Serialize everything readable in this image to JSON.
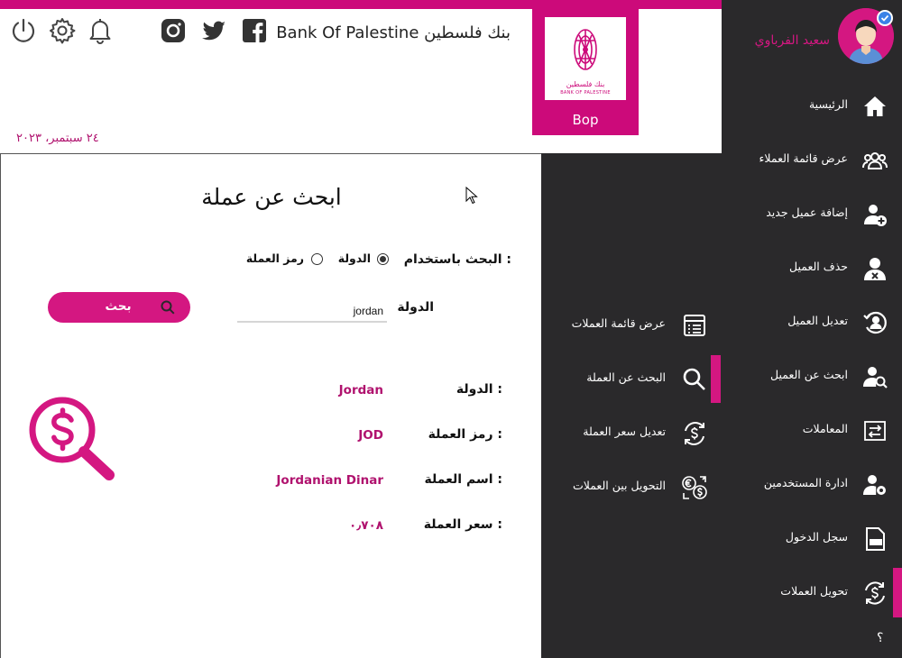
{
  "header": {
    "bank_title": "Bank Of Palestine بنك فلسطين",
    "date": "٢٤ سبتمبر، ٢٠٢٣",
    "logo": {
      "caption": "Bop",
      "text_ar": "بنك فلسطين",
      "text_en": "BANK OF PALESTINE"
    },
    "icons": [
      "power-icon",
      "gear-icon",
      "bell-icon",
      "instagram-icon",
      "twitter-icon",
      "facebook-icon"
    ]
  },
  "user": {
    "name": "سعيد الفرباوي"
  },
  "sidebar": {
    "items": [
      {
        "label": "الرئيسية",
        "icon": "home-icon"
      },
      {
        "label": "عرض قائمة العملاء",
        "icon": "users-icon"
      },
      {
        "label": "إضافة عميل جديد",
        "icon": "add-user-icon"
      },
      {
        "label": "حذف العميل",
        "icon": "delete-user-icon"
      },
      {
        "label": "تعديل العميل",
        "icon": "edit-user-icon"
      },
      {
        "label": "ابحث عن العميل",
        "icon": "search-user-icon"
      },
      {
        "label": "المعاملات",
        "icon": "transactions-icon"
      },
      {
        "label": "ادارة المستخدمين",
        "icon": "manage-users-icon"
      },
      {
        "label": "سجل الدخول",
        "icon": "log-icon"
      },
      {
        "label": "تحويل العملات",
        "icon": "currency-exchange-icon"
      }
    ],
    "help": "؟"
  },
  "subnav": {
    "items": [
      {
        "label": "عرض قائمة العملات",
        "icon": "list-icon"
      },
      {
        "label": "البحث عن العملة",
        "icon": "search-icon"
      },
      {
        "label": "تعديل سعر العملة",
        "icon": "currency-refresh-icon"
      },
      {
        "label": "التحويل بين العملات",
        "icon": "currency-convert-icon"
      }
    ]
  },
  "main": {
    "title": "ابحث عن عملة",
    "search_by_label": "البحث باستخدام :",
    "radio_country": "الدولة",
    "radio_code": "رمز العملة",
    "country_label": "الدولة",
    "country_value": "jordan",
    "search_button": "بحث",
    "results": {
      "country_label": "الدولة :",
      "country_value": "Jordan",
      "code_label": "رمز العملة :",
      "code_value": "JOD",
      "name_label": "اسم العملة :",
      "name_value": "Jordanian Dinar",
      "rate_label": "سعر العملة :",
      "rate_value": "٠٫٧٠٨"
    }
  },
  "colors": {
    "accent": "#d41781",
    "sidebar_bg": "#2a292b",
    "value_text": "#b0126e"
  }
}
